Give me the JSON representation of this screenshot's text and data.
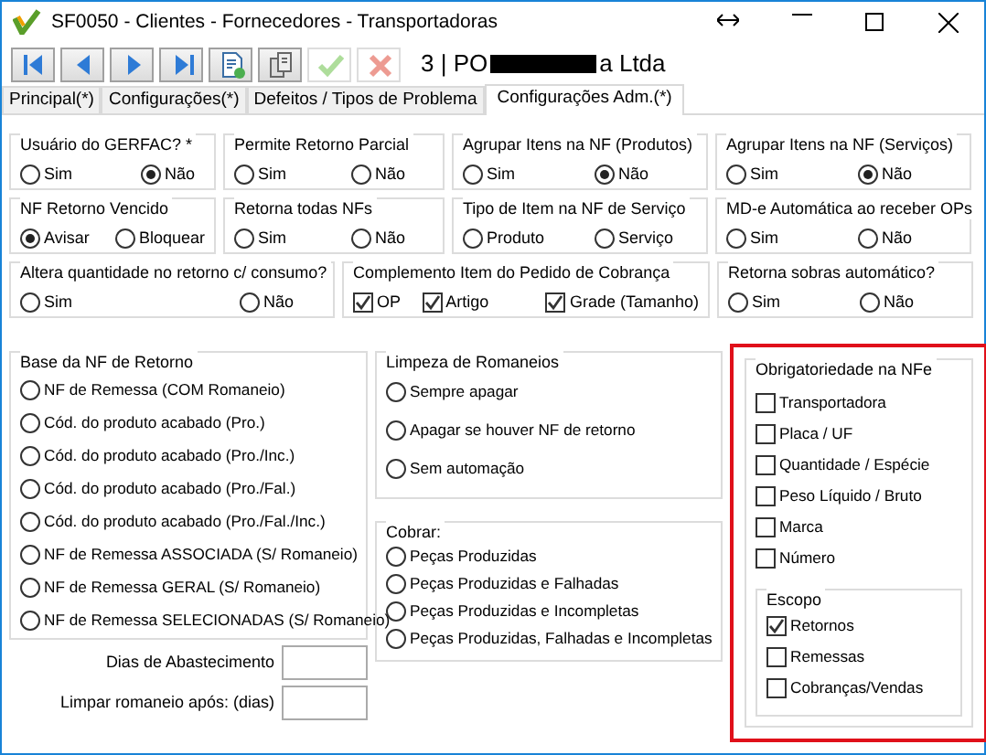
{
  "window": {
    "title": "SF0050 - Clientes - Fornecedores - Transportadoras"
  },
  "toolbar": [
    {
      "kind": "first",
      "disabled": false
    },
    {
      "kind": "prev",
      "disabled": false
    },
    {
      "kind": "next",
      "disabled": false
    },
    {
      "kind": "last",
      "disabled": false
    },
    {
      "kind": "new",
      "disabled": false
    },
    {
      "kind": "copy",
      "disabled": false
    },
    {
      "kind": "confirm",
      "disabled": true
    },
    {
      "kind": "cancel",
      "disabled": true
    }
  ],
  "record": {
    "prefix": "3 | PO",
    "redacted": true,
    "suffix": "a Ltda"
  },
  "tabs": [
    {
      "label": "Principal(*)",
      "selected": false
    },
    {
      "label": "Configurações(*)",
      "selected": false
    },
    {
      "label": "Defeitos / Tipos de Problema",
      "selected": false
    },
    {
      "label": "Configurações Adm.(*)",
      "selected": true
    }
  ],
  "option_rows": [
    [
      {
        "title": "Usuário do GERFAC? *",
        "kind": "radio",
        "options": [
          {
            "label": "Sim",
            "selected": false
          },
          {
            "label": "Não",
            "selected": true
          }
        ]
      },
      {
        "title": "Permite Retorno Parcial",
        "kind": "radio",
        "options": [
          {
            "label": "Sim",
            "selected": false
          },
          {
            "label": "Não",
            "selected": false
          }
        ]
      },
      {
        "title": "Agrupar Itens na NF (Produtos)",
        "kind": "radio",
        "options": [
          {
            "label": "Sim",
            "selected": false
          },
          {
            "label": "Não",
            "selected": true
          }
        ]
      },
      {
        "title": "Agrupar Itens na NF (Serviços)",
        "kind": "radio",
        "options": [
          {
            "label": "Sim",
            "selected": false
          },
          {
            "label": "Não",
            "selected": true
          }
        ]
      }
    ],
    [
      {
        "title": "NF Retorno Vencido",
        "kind": "radio",
        "options": [
          {
            "label": "Avisar",
            "selected": true
          },
          {
            "label": "Bloquear",
            "selected": false
          }
        ]
      },
      {
        "title": "Retorna todas NFs",
        "kind": "radio",
        "options": [
          {
            "label": "Sim",
            "selected": false
          },
          {
            "label": "Não",
            "selected": false
          }
        ]
      },
      {
        "title": "Tipo de Item na NF de Serviço",
        "kind": "radio",
        "options": [
          {
            "label": "Produto",
            "selected": false
          },
          {
            "label": "Serviço",
            "selected": false
          }
        ]
      },
      {
        "title": "MD-e Automática ao receber OPs",
        "kind": "radio",
        "options": [
          {
            "label": "Sim",
            "selected": false
          },
          {
            "label": "Não",
            "selected": false
          }
        ]
      }
    ],
    [
      {
        "title": "Altera quantidade no retorno c/ consumo?",
        "kind": "radio",
        "options": [
          {
            "label": "Sim",
            "selected": false
          },
          {
            "label": "Não",
            "selected": false
          }
        ]
      },
      {
        "title": "Complemento Item do Pedido de Cobrança",
        "kind": "check",
        "options": [
          {
            "label": "OP",
            "checked": true
          },
          {
            "label": "Artigo",
            "checked": true
          },
          {
            "label": "Grade (Tamanho)",
            "checked": true
          }
        ]
      },
      {
        "title": "Retorna sobras automático?",
        "kind": "radio",
        "options": [
          {
            "label": "Sim",
            "selected": false
          },
          {
            "label": "Não",
            "selected": false
          }
        ]
      }
    ]
  ],
  "base_nf_retorno": {
    "title": "Base da NF de Retorno",
    "options": [
      {
        "label": "NF de Remessa (COM Romaneio)",
        "selected": false
      },
      {
        "label": "Cód. do produto acabado (Pro.)",
        "selected": false
      },
      {
        "label": "Cód. do produto acabado (Pro./Inc.)",
        "selected": false
      },
      {
        "label": "Cód. do produto acabado (Pro./Fal.)",
        "selected": false
      },
      {
        "label": "Cód. do produto acabado (Pro./Fal./Inc.)",
        "selected": false
      },
      {
        "label": "NF de Remessa ASSOCIADA (S/ Romaneio)",
        "selected": false
      },
      {
        "label": "NF de Remessa GERAL (S/ Romaneio)",
        "selected": false
      },
      {
        "label": "NF de Remessa SELECIONADAS (S/ Romaneio)",
        "selected": false
      }
    ]
  },
  "fields": [
    {
      "label": "Dias de Abastecimento"
    },
    {
      "label": "Limpar romaneio após: (dias)"
    }
  ],
  "limpeza_romaneios": {
    "title": "Limpeza de Romaneios",
    "options": [
      {
        "label": "Sempre apagar",
        "selected": false
      },
      {
        "label": "Apagar se houver NF de retorno",
        "selected": false
      },
      {
        "label": "Sem automação",
        "selected": false
      }
    ]
  },
  "cobrar": {
    "title": "Cobrar:",
    "options": [
      {
        "label": "Peças Produzidas",
        "selected": false
      },
      {
        "label": "Peças Produzidas e Falhadas",
        "selected": false
      },
      {
        "label": "Peças Produzidas e Incompletas",
        "selected": false
      },
      {
        "label": "Peças Produzidas, Falhadas e Incompletas",
        "selected": false
      }
    ]
  },
  "obrigatoriedade": {
    "title": "Obrigatoriedade na NFe",
    "highlighted": true,
    "items": [
      {
        "label": "Transportadora",
        "checked": false
      },
      {
        "label": "Placa / UF",
        "checked": false
      },
      {
        "label": "Quantidade / Espécie",
        "checked": false
      },
      {
        "label": "Peso Líquido / Bruto",
        "checked": false
      },
      {
        "label": "Marca",
        "checked": false
      },
      {
        "label": "Número",
        "checked": false
      }
    ],
    "escopo": {
      "title": "Escopo",
      "items": [
        {
          "label": "Retornos",
          "checked": true
        },
        {
          "label": "Remessas",
          "checked": false
        },
        {
          "label": "Cobranças/Vendas",
          "checked": false
        }
      ]
    }
  }
}
